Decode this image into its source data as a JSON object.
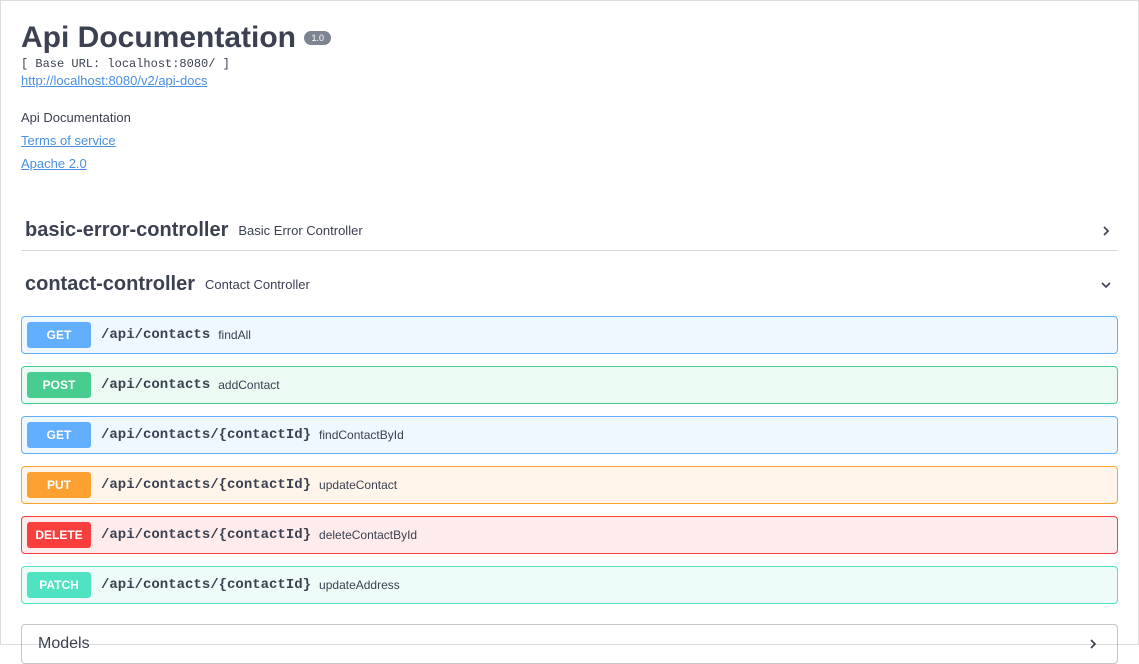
{
  "header": {
    "title": "Api Documentation",
    "version": "1.0",
    "baseUrl": "[ Base URL: localhost:8080/ ]",
    "docsLink": "http://localhost:8080/v2/api-docs",
    "description": "Api Documentation",
    "terms": "Terms of service",
    "license": "Apache 2.0"
  },
  "controllers": [
    {
      "name": "basic-error-controller",
      "desc": "Basic Error Controller",
      "expanded": false
    },
    {
      "name": "contact-controller",
      "desc": "Contact Controller",
      "expanded": true
    }
  ],
  "endpoints": [
    {
      "method": "GET",
      "path": "/api/contacts",
      "op": "findAll"
    },
    {
      "method": "POST",
      "path": "/api/contacts",
      "op": "addContact"
    },
    {
      "method": "GET",
      "path": "/api/contacts/{contactId}",
      "op": "findContactById"
    },
    {
      "method": "PUT",
      "path": "/api/contacts/{contactId}",
      "op": "updateContact"
    },
    {
      "method": "DELETE",
      "path": "/api/contacts/{contactId}",
      "op": "deleteContactById"
    },
    {
      "method": "PATCH",
      "path": "/api/contacts/{contactId}",
      "op": "updateAddress"
    }
  ],
  "models": {
    "title": "Models"
  }
}
